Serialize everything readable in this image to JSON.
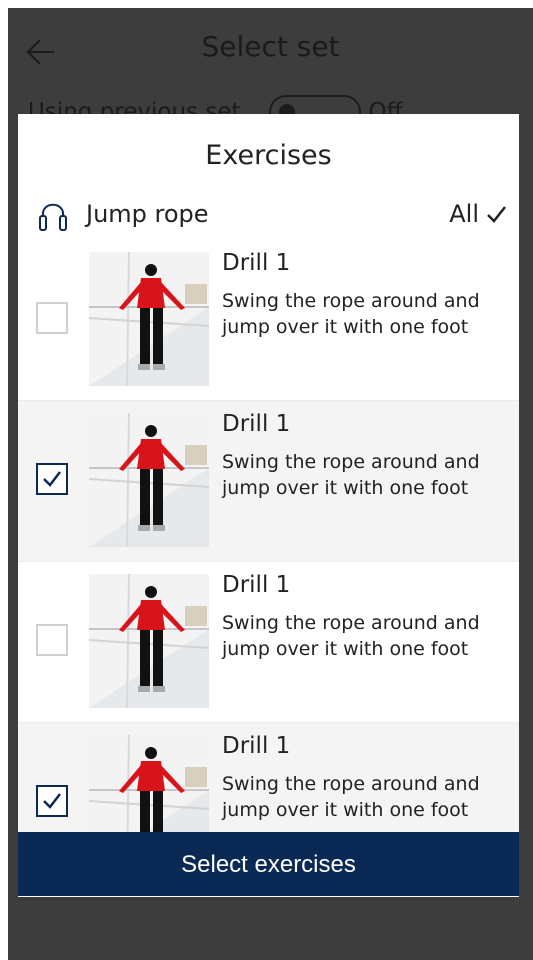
{
  "header": {
    "title": "Select set",
    "previous_set_label": "Using previous set",
    "toggle_state": "Off"
  },
  "modal": {
    "title": "Exercises",
    "group_label": "Jump rope",
    "all_label": "All",
    "items": [
      {
        "title": "Drill 1",
        "description": "Swing the rope around and jump over it with one foot",
        "checked": false
      },
      {
        "title": "Drill 1",
        "description": "Swing the rope around and jump over it with one foot",
        "checked": true
      },
      {
        "title": "Drill 1",
        "description": "Swing the rope around and jump over it with one foot",
        "checked": false
      },
      {
        "title": "Drill 1",
        "description": "Swing the rope around and jump over it with one foot",
        "checked": true
      }
    ]
  },
  "cta": {
    "label": "Select exercises"
  },
  "colors": {
    "accent": "#0b2955",
    "overlay": "#3d3d3d"
  },
  "icons": [
    "back-arrow-icon",
    "jump-rope-icon",
    "checkmark-icon"
  ]
}
